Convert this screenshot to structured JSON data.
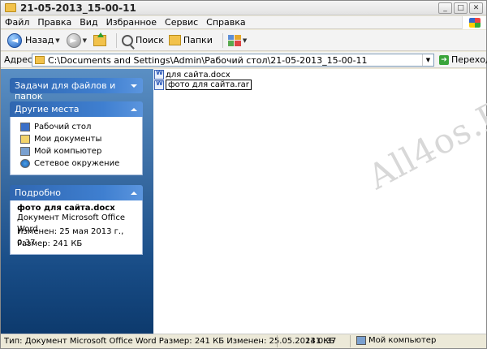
{
  "window": {
    "title": "21-05-2013_15-00-11"
  },
  "menu": [
    "Файл",
    "Правка",
    "Вид",
    "Избранное",
    "Сервис",
    "Справка"
  ],
  "toolbar": {
    "back_label": "Назад",
    "search_label": "Поиск",
    "folders_label": "Папки"
  },
  "address": {
    "label": "Адрес:",
    "value": "C:\\Documents and Settings\\Admin\\Рабочий стол\\21-05-2013_15-00-11",
    "go_label": "Переход"
  },
  "sidebar": {
    "tasks_title": "Задачи для файлов и папок",
    "places_title": "Другие места",
    "places": [
      "Рабочий стол",
      "Мои документы",
      "Мой компьютер",
      "Сетевое окружение"
    ],
    "details_title": "Подробно",
    "details": {
      "name": "фото для сайта.docx",
      "type": "Документ Microsoft Office Word",
      "modified": "Изменен: 25 мая 2013 г., 0:37",
      "size": "Размер: 241 КБ"
    }
  },
  "files": [
    {
      "name": "для сайта.docx",
      "icon": "word-doc-icon"
    },
    {
      "name": "фото для сайта.rar",
      "icon": "word-doc-icon",
      "renaming": true
    }
  ],
  "watermark": "All4os.RU",
  "status": {
    "info": "Тип: Документ Microsoft Office Word Размер: 241 КБ Изменен: 25.05.2013 0:37",
    "size": "241 КБ",
    "location": "Мой компьютер"
  }
}
